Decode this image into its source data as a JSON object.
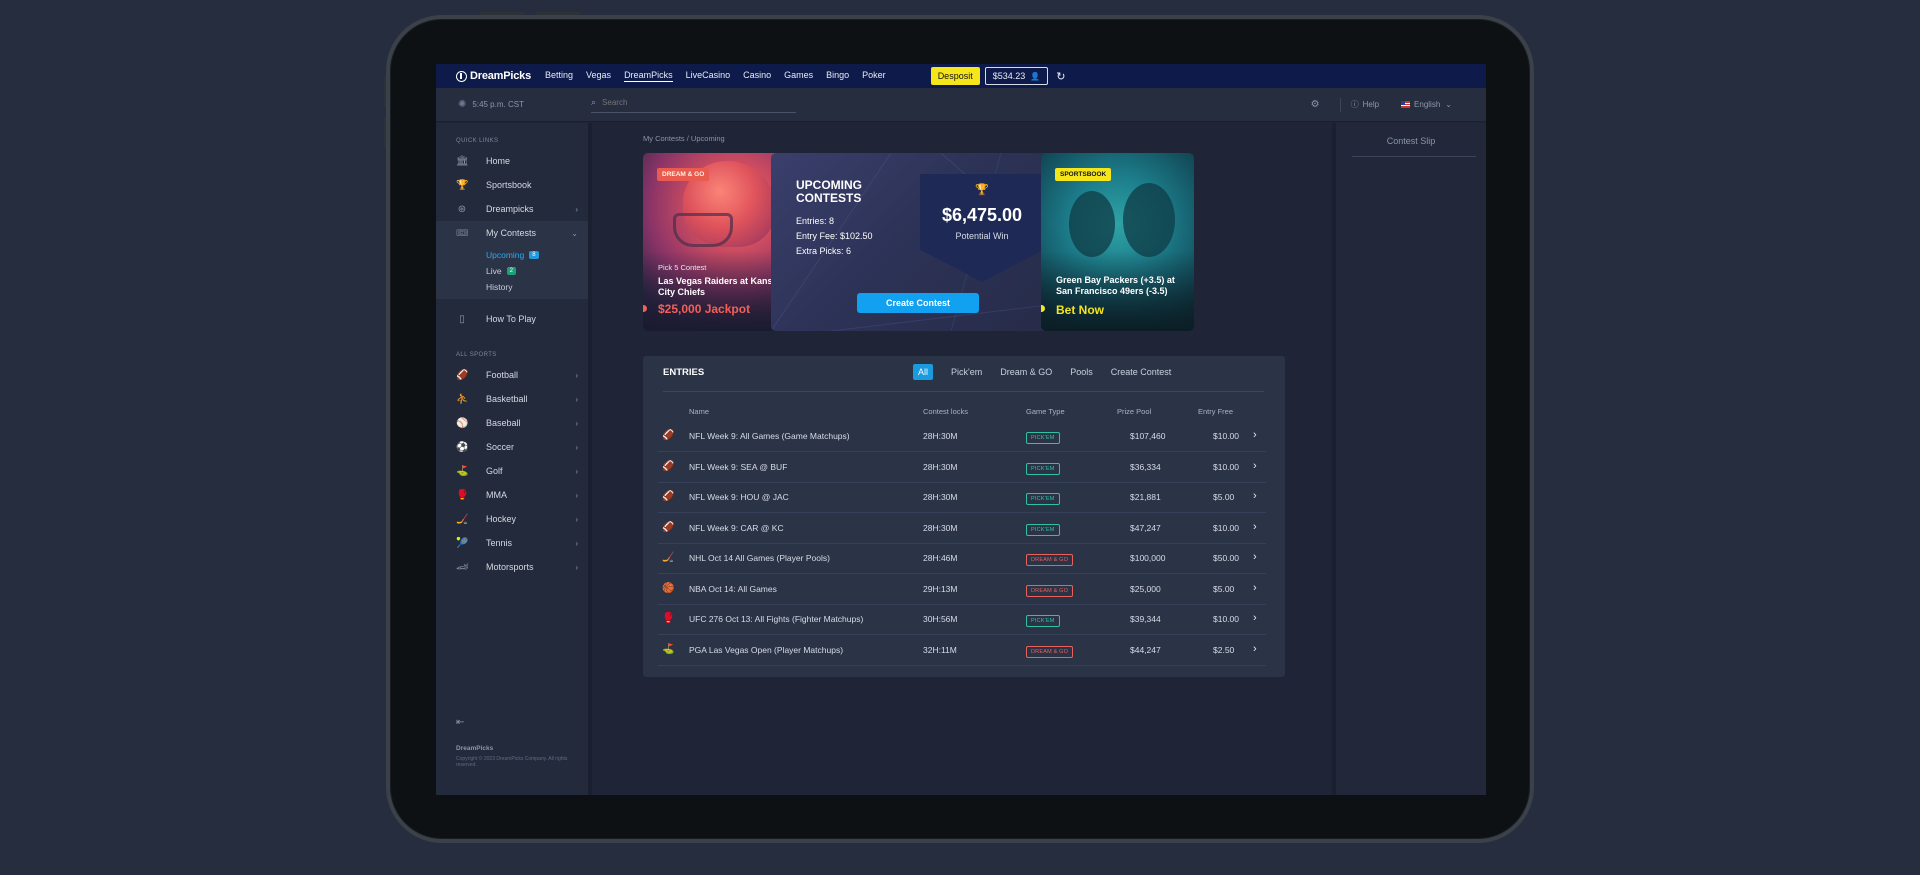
{
  "nav": {
    "brand": "DreamPicks",
    "links": [
      "Betting",
      "Vegas",
      "DreamPicks",
      "LiveCasino",
      "Casino",
      "Games",
      "Bingo",
      "Poker"
    ],
    "deposit_label": "Desposit",
    "balance": "$534.23"
  },
  "subbar": {
    "time": "5:45 p.m. CST",
    "search_placeholder": "Search",
    "help_label": "Help",
    "language": "English"
  },
  "sidebar": {
    "quick_links_heading": "QUICK LINKS",
    "home": "Home",
    "sportsbook": "Sportsbook",
    "dreampicks": "Dreampicks",
    "my_contests": "My Contests",
    "upcoming": "Upcoming",
    "upcoming_count": "8",
    "live": "Live",
    "live_count": "2",
    "history": "History",
    "how_to_play": "How To Play",
    "all_sports_heading": "ALL SPORTS",
    "sports": [
      "Football",
      "Basketball",
      "Baseball",
      "Soccer",
      "Golf",
      "MMA",
      "Hockey",
      "Tennis",
      "Motorsports"
    ],
    "footer_brand": "DreamPicks",
    "copyright": "Copyright © 2023 DreamPicks Company. All rights reserved."
  },
  "breadcrumb": "My Contests / Upcoming",
  "promo1": {
    "tag": "DREAM & GO",
    "subtitle": "Pick 5 Contest",
    "title": "Las Vegas Raiders at Kansas City Chiefs",
    "cta": "$25,000 Jackpot"
  },
  "promo2": {
    "title": "UPCOMING CONTESTS",
    "entries": "Entries:  8",
    "entry_fee": "Entry Fee:  $102.50",
    "extra_picks": "Extra Picks:  6",
    "amount": "$6,475.00",
    "amount_label": "Potential Win",
    "button": "Create Contest"
  },
  "promo3": {
    "tag": "SPORTSBOOK",
    "title": "Green Bay Packers (+3.5) at San Francisco 49ers (-3.5)",
    "cta": "Bet Now"
  },
  "entries": {
    "heading": "ENTRIES",
    "tabs": [
      "All",
      "Pick'em",
      "Dream & GO",
      "Pools",
      "Create Contest"
    ],
    "columns": [
      "Name",
      "Contest locks",
      "Game Type",
      "Prize Pool",
      "Entry Free"
    ],
    "rows": [
      {
        "name": "NFL Week 9: All Games (Game Matchups)",
        "locks": "28H:30M",
        "type": "PICK'EM",
        "pool": "$107,460",
        "fee": "$10.00",
        "icon": "football-icon"
      },
      {
        "name": "NFL Week 9: SEA @ BUF",
        "locks": "28H:30M",
        "type": "PICK'EM",
        "pool": "$36,334",
        "fee": "$10.00",
        "icon": "football-icon"
      },
      {
        "name": "NFL Week 9: HOU @ JAC",
        "locks": "28H:30M",
        "type": "PICK'EM",
        "pool": "$21,881",
        "fee": "$5.00",
        "icon": "football-icon"
      },
      {
        "name": "NFL Week 9: CAR @ KC",
        "locks": "28H:30M",
        "type": "PICK'EM",
        "pool": "$47,247",
        "fee": "$10.00",
        "icon": "football-icon"
      },
      {
        "name": "NHL Oct 14 All Games (Player Pools)",
        "locks": "28H:46M",
        "type": "DREAM & GO",
        "pool": "$100,000",
        "fee": "$50.00",
        "icon": "hockey-icon"
      },
      {
        "name": "NBA Oct 14: All Games",
        "locks": "29H:13M",
        "type": "DREAM & GO",
        "pool": "$25,000",
        "fee": "$5.00",
        "icon": "basketball-icon"
      },
      {
        "name": "UFC 276 Oct 13: All Fights (Fighter Matchups)",
        "locks": "30H:56M",
        "type": "PICK'EM",
        "pool": "$39,344",
        "fee": "$10.00",
        "icon": "mma-icon"
      },
      {
        "name": "PGA Las Vegas Open (Player Matchups)",
        "locks": "32H:11M",
        "type": "DREAM & GO",
        "pool": "$44,247",
        "fee": "$2.50",
        "icon": "golf-icon"
      }
    ]
  },
  "slip": {
    "title": "Contest Slip"
  },
  "colors": {
    "accent": "#12a1f0",
    "deposit": "#f5e61b",
    "pickem": "#2ec2a0",
    "dreamgo": "#e8615a",
    "nav_bg": "#0e1a4a"
  }
}
